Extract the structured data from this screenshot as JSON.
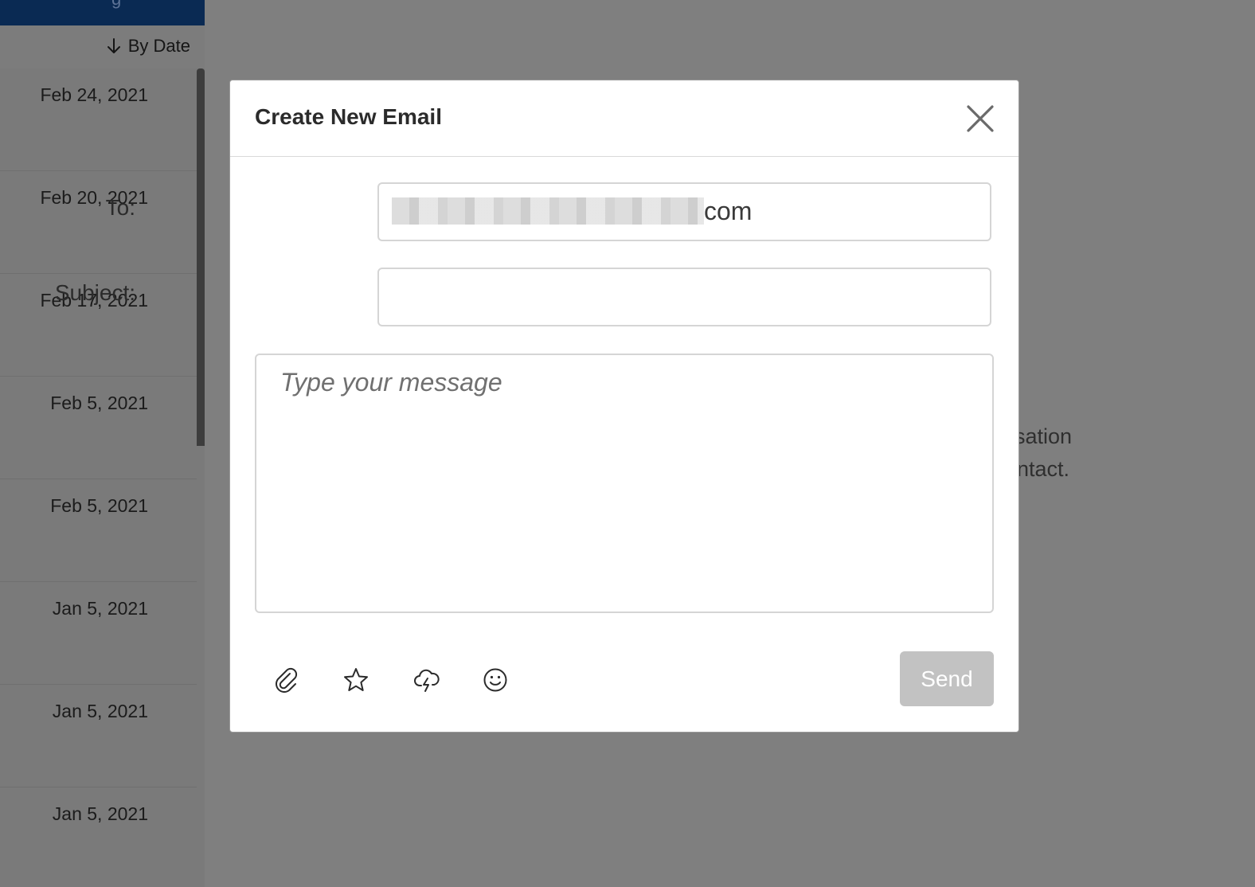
{
  "sidebar": {
    "header_fragment": "g",
    "sort_label": "By Date",
    "sort_icon": "arrow-down-icon",
    "dates": [
      "Feb 24, 2021",
      "Feb 20, 2021",
      "Feb 17, 2021",
      "Feb 5, 2021",
      "Feb 5, 2021",
      "Jan 5, 2021",
      "Jan 5, 2021",
      "Jan 5, 2021"
    ]
  },
  "background": {
    "empty_line1": "sation",
    "empty_line2": "ntact."
  },
  "modal": {
    "title": "Create New Email",
    "close_icon": "close-icon",
    "to_label": "To:",
    "to_value_visible": "com",
    "subject_label": "Subject:",
    "subject_value": "",
    "message_placeholder": "Type your message",
    "toolbar_icons": [
      "paperclip-icon",
      "star-icon",
      "cloud-lightning-icon",
      "smiley-icon"
    ],
    "send_label": "Send",
    "send_color": "#c2c2c2"
  },
  "colors": {
    "header_bg": "#0a2a53",
    "overlay": "#7f7f7f"
  }
}
